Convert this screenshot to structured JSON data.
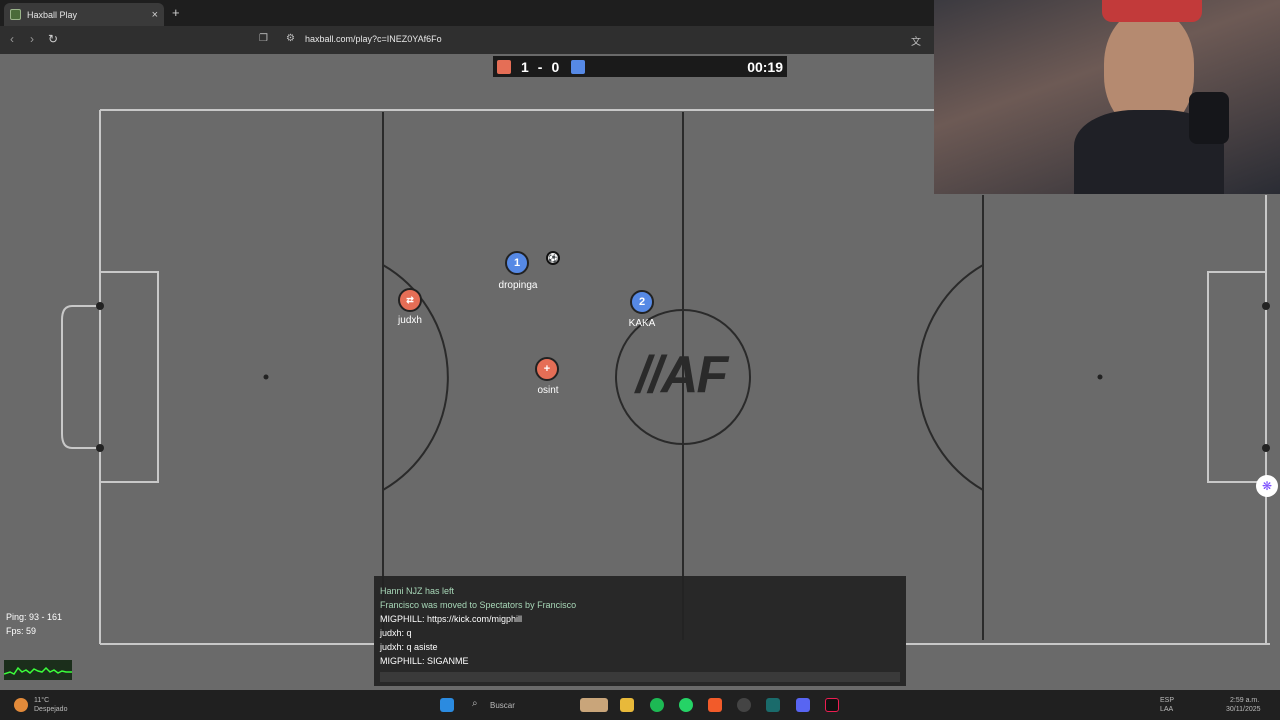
{
  "browser": {
    "tab_title": "Haxball Play",
    "tab_close": "×",
    "new_tab": "+",
    "url": "haxball.com/play?c=INEZ0YAf6Fo"
  },
  "scoreboard": {
    "red_score": "1",
    "separator": "-",
    "blue_score": "0",
    "time": "00:19",
    "red_color": "#e56e56",
    "blue_color": "#5689e5"
  },
  "field": {
    "logo": "//AF"
  },
  "players": [
    {
      "name": "dropinga",
      "number": "1",
      "team": "blue"
    },
    {
      "name": "KAKA",
      "number": "2",
      "team": "blue"
    },
    {
      "name": "judxh",
      "number": "",
      "team": "red"
    },
    {
      "name": "osint",
      "number": "+",
      "team": "red"
    }
  ],
  "stats": {
    "ping": "Ping: 93 - 161",
    "fps": "Fps: 59"
  },
  "chat": {
    "messages": [
      {
        "text": "Hanni NJZ has left",
        "type": "system"
      },
      {
        "text": "Francisco was moved to Spectators by Francisco",
        "type": "system"
      },
      {
        "text": "MIGPHILL: https://kick.com/migphill",
        "type": "user"
      },
      {
        "text": "judxh: q",
        "type": "user"
      },
      {
        "text": "judxh: q asiste",
        "type": "user"
      },
      {
        "text": "MIGPHILL: SIGANME",
        "type": "user"
      }
    ]
  },
  "taskbar": {
    "weather_temp": "11°C",
    "weather_desc": "Despejado",
    "search": "Buscar",
    "lang": "ESP",
    "lang_sub": "LAA",
    "time": "2:59 a.m.",
    "date": "30/11/2025"
  }
}
